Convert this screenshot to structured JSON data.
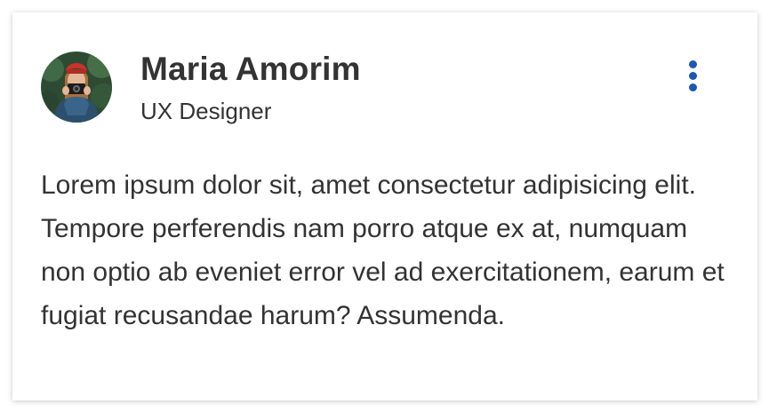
{
  "profile": {
    "name": "Maria Amorim",
    "role": "UX Designer"
  },
  "post": {
    "text": "Lorem ipsum dolor sit, amet consectetur adipisicing elit. Tempore perferendis nam porro atque ex at, numquam non optio ab eveniet error vel ad exercitationem, earum et fugiat recusandae harum? Assumenda."
  },
  "icons": {
    "more": "more-vertical-icon"
  },
  "colors": {
    "accent": "#1c57b1",
    "text": "#333333",
    "card_bg": "#ffffff"
  }
}
